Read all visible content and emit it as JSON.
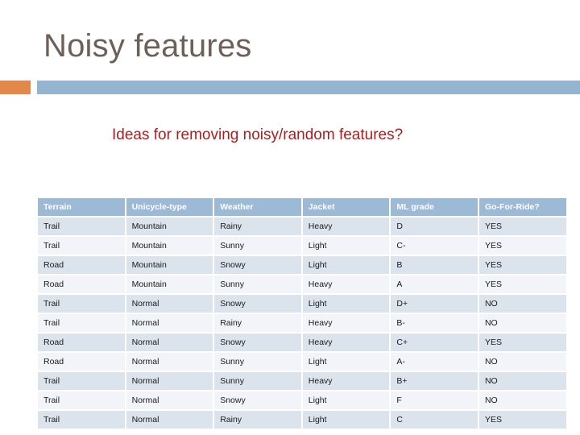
{
  "slide": {
    "title": "Noisy features",
    "subtitle": "Ideas for removing noisy/random features?",
    "colors": {
      "title_text": "#6e5f58",
      "subtitle_text": "#b01c1c",
      "divider_orange": "#e2884a",
      "divider_blue": "#94b4d2",
      "table_header_bg": "#9cbad6",
      "table_row_odd_bg": "#dbe3ec",
      "table_row_even_bg": "#f1f4f8"
    }
  },
  "table": {
    "columns": [
      "Terrain",
      "Unicycle-type",
      "Weather",
      "Jacket",
      "ML grade",
      "Go-For-Ride?"
    ],
    "rows": [
      [
        "Trail",
        "Mountain",
        "Rainy",
        "Heavy",
        "D",
        "YES"
      ],
      [
        "Trail",
        "Mountain",
        "Sunny",
        "Light",
        "C-",
        "YES"
      ],
      [
        "Road",
        "Mountain",
        "Snowy",
        "Light",
        "B",
        "YES"
      ],
      [
        "Road",
        "Mountain",
        "Sunny",
        "Heavy",
        "A",
        "YES"
      ],
      [
        "Trail",
        "Normal",
        "Snowy",
        "Light",
        "D+",
        "NO"
      ],
      [
        "Trail",
        "Normal",
        "Rainy",
        "Heavy",
        "B-",
        "NO"
      ],
      [
        "Road",
        "Normal",
        "Snowy",
        "Heavy",
        "C+",
        "YES"
      ],
      [
        "Road",
        "Normal",
        "Sunny",
        "Light",
        "A-",
        "NO"
      ],
      [
        "Trail",
        "Normal",
        "Sunny",
        "Heavy",
        "B+",
        "NO"
      ],
      [
        "Trail",
        "Normal",
        "Snowy",
        "Light",
        "F",
        "NO"
      ],
      [
        "Trail",
        "Normal",
        "Rainy",
        "Light",
        "C",
        "YES"
      ]
    ]
  }
}
